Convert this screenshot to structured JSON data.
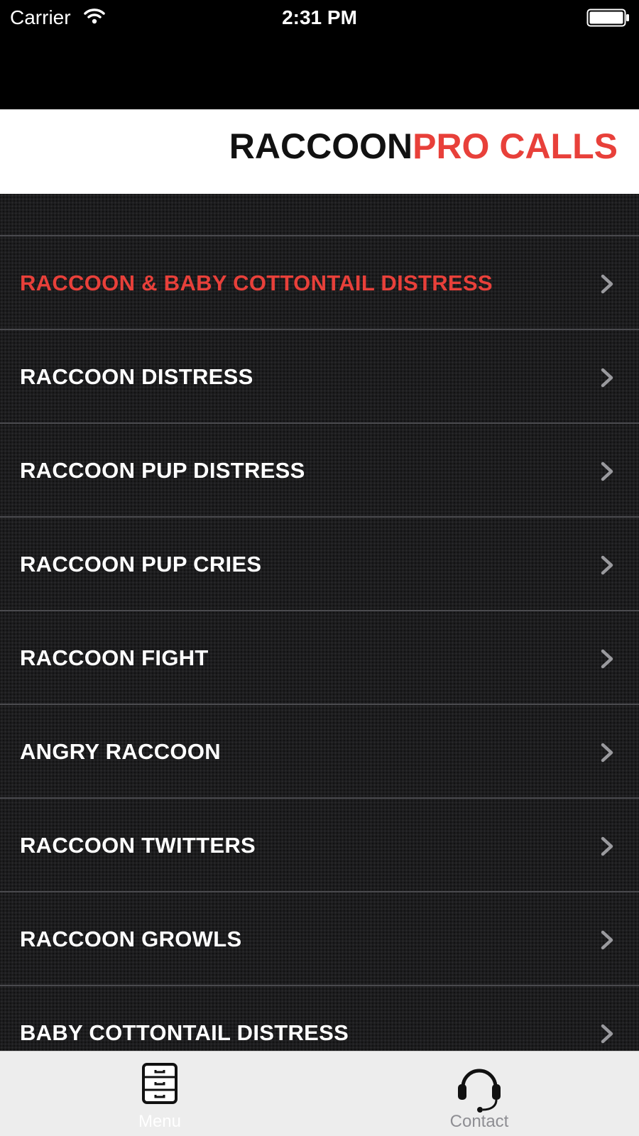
{
  "status_bar": {
    "carrier": "Carrier",
    "time": "2:31 PM",
    "wifi_icon": "wifi-icon",
    "battery_icon": "battery-icon"
  },
  "header": {
    "title_part1": "RACCOON",
    "title_part2": "PRO CALLS",
    "title_part1_color": "#111111",
    "title_part2_color": "#e8403a"
  },
  "list": {
    "active_color": "#e8403a",
    "items": [
      {
        "label": "RACCOON & BABY COTTONTAIL DISTRESS",
        "active": true
      },
      {
        "label": "RACCOON DISTRESS",
        "active": false
      },
      {
        "label": "RACCOON PUP DISTRESS",
        "active": false
      },
      {
        "label": "RACCOON PUP CRIES",
        "active": false
      },
      {
        "label": "RACCOON FIGHT",
        "active": false
      },
      {
        "label": "ANGRY RACCOON",
        "active": false
      },
      {
        "label": "RACCOON TWITTERS",
        "active": false
      },
      {
        "label": "RACCOON GROWLS",
        "active": false
      },
      {
        "label": "BABY COTTONTAIL DISTRESS",
        "active": false
      }
    ]
  },
  "tab_bar": {
    "tabs": [
      {
        "label": "Menu",
        "icon": "file-cabinet-icon",
        "selected": true
      },
      {
        "label": "Contact",
        "icon": "headset-icon",
        "selected": false
      }
    ]
  }
}
